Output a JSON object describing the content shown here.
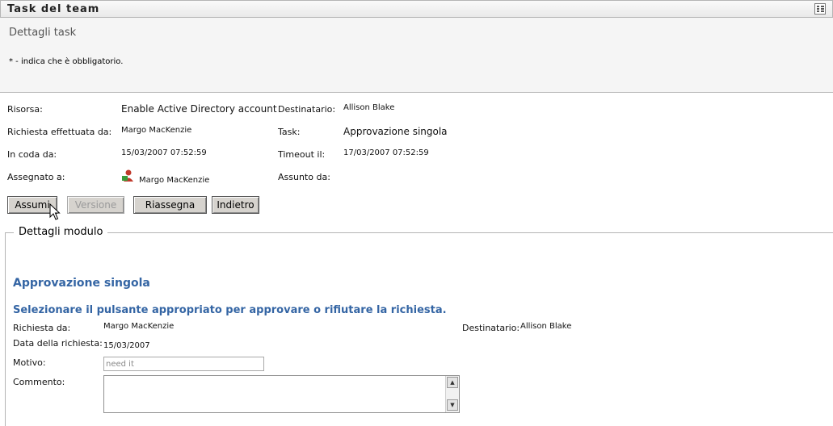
{
  "window": {
    "title": "Task del team",
    "menu_icon": "grid-menu-icon"
  },
  "header": {
    "heading": "Dettagli task",
    "required_note": "* - indica che è obbligatorio."
  },
  "details": {
    "risorsa": {
      "label": "Risorsa:",
      "value": "Enable Active Directory account"
    },
    "destinatario": {
      "label": "Destinatario:",
      "value": "Allison Blake"
    },
    "richiesta": {
      "label": "Richiesta effettuata da:",
      "value": "Margo MacKenzie"
    },
    "task": {
      "label": "Task:",
      "value": "Approvazione singola"
    },
    "in_coda": {
      "label": "In coda da:",
      "value": "15/03/2007 07:52:59"
    },
    "timeout": {
      "label": "Timeout il:",
      "value": "17/03/2007 07:52:59"
    },
    "assegnato": {
      "label": "Assegnato a:",
      "value": "Margo MacKenzie",
      "icon": "user-icon"
    },
    "assunto": {
      "label": "Assunto da:",
      "value": ""
    }
  },
  "buttons": {
    "assumi": "Assumi",
    "versione": "Versione",
    "riassegna": "Riassegna",
    "indietro": "Indietro"
  },
  "form": {
    "legend": "Dettagli modulo",
    "title": "Approvazione singola",
    "instruction": "Selezionare il pulsante appropriato per approvare o rifiutare la richiesta.",
    "richiesta_da": {
      "label": "Richiesta da:",
      "value": "Margo MacKenzie"
    },
    "destinatario": {
      "label": "Destinatario:",
      "value": "Allison Blake"
    },
    "data_richiesta": {
      "label": "Data della richiesta:",
      "value": "15/03/2007"
    },
    "motivo": {
      "label": "Motivo:",
      "placeholder": "need it"
    },
    "commento": {
      "label": "Commento:",
      "value": ""
    }
  },
  "colors": {
    "accent": "#3465a4",
    "button_bg": "#d6d3ce",
    "header_bg": "#f5f5f5"
  }
}
